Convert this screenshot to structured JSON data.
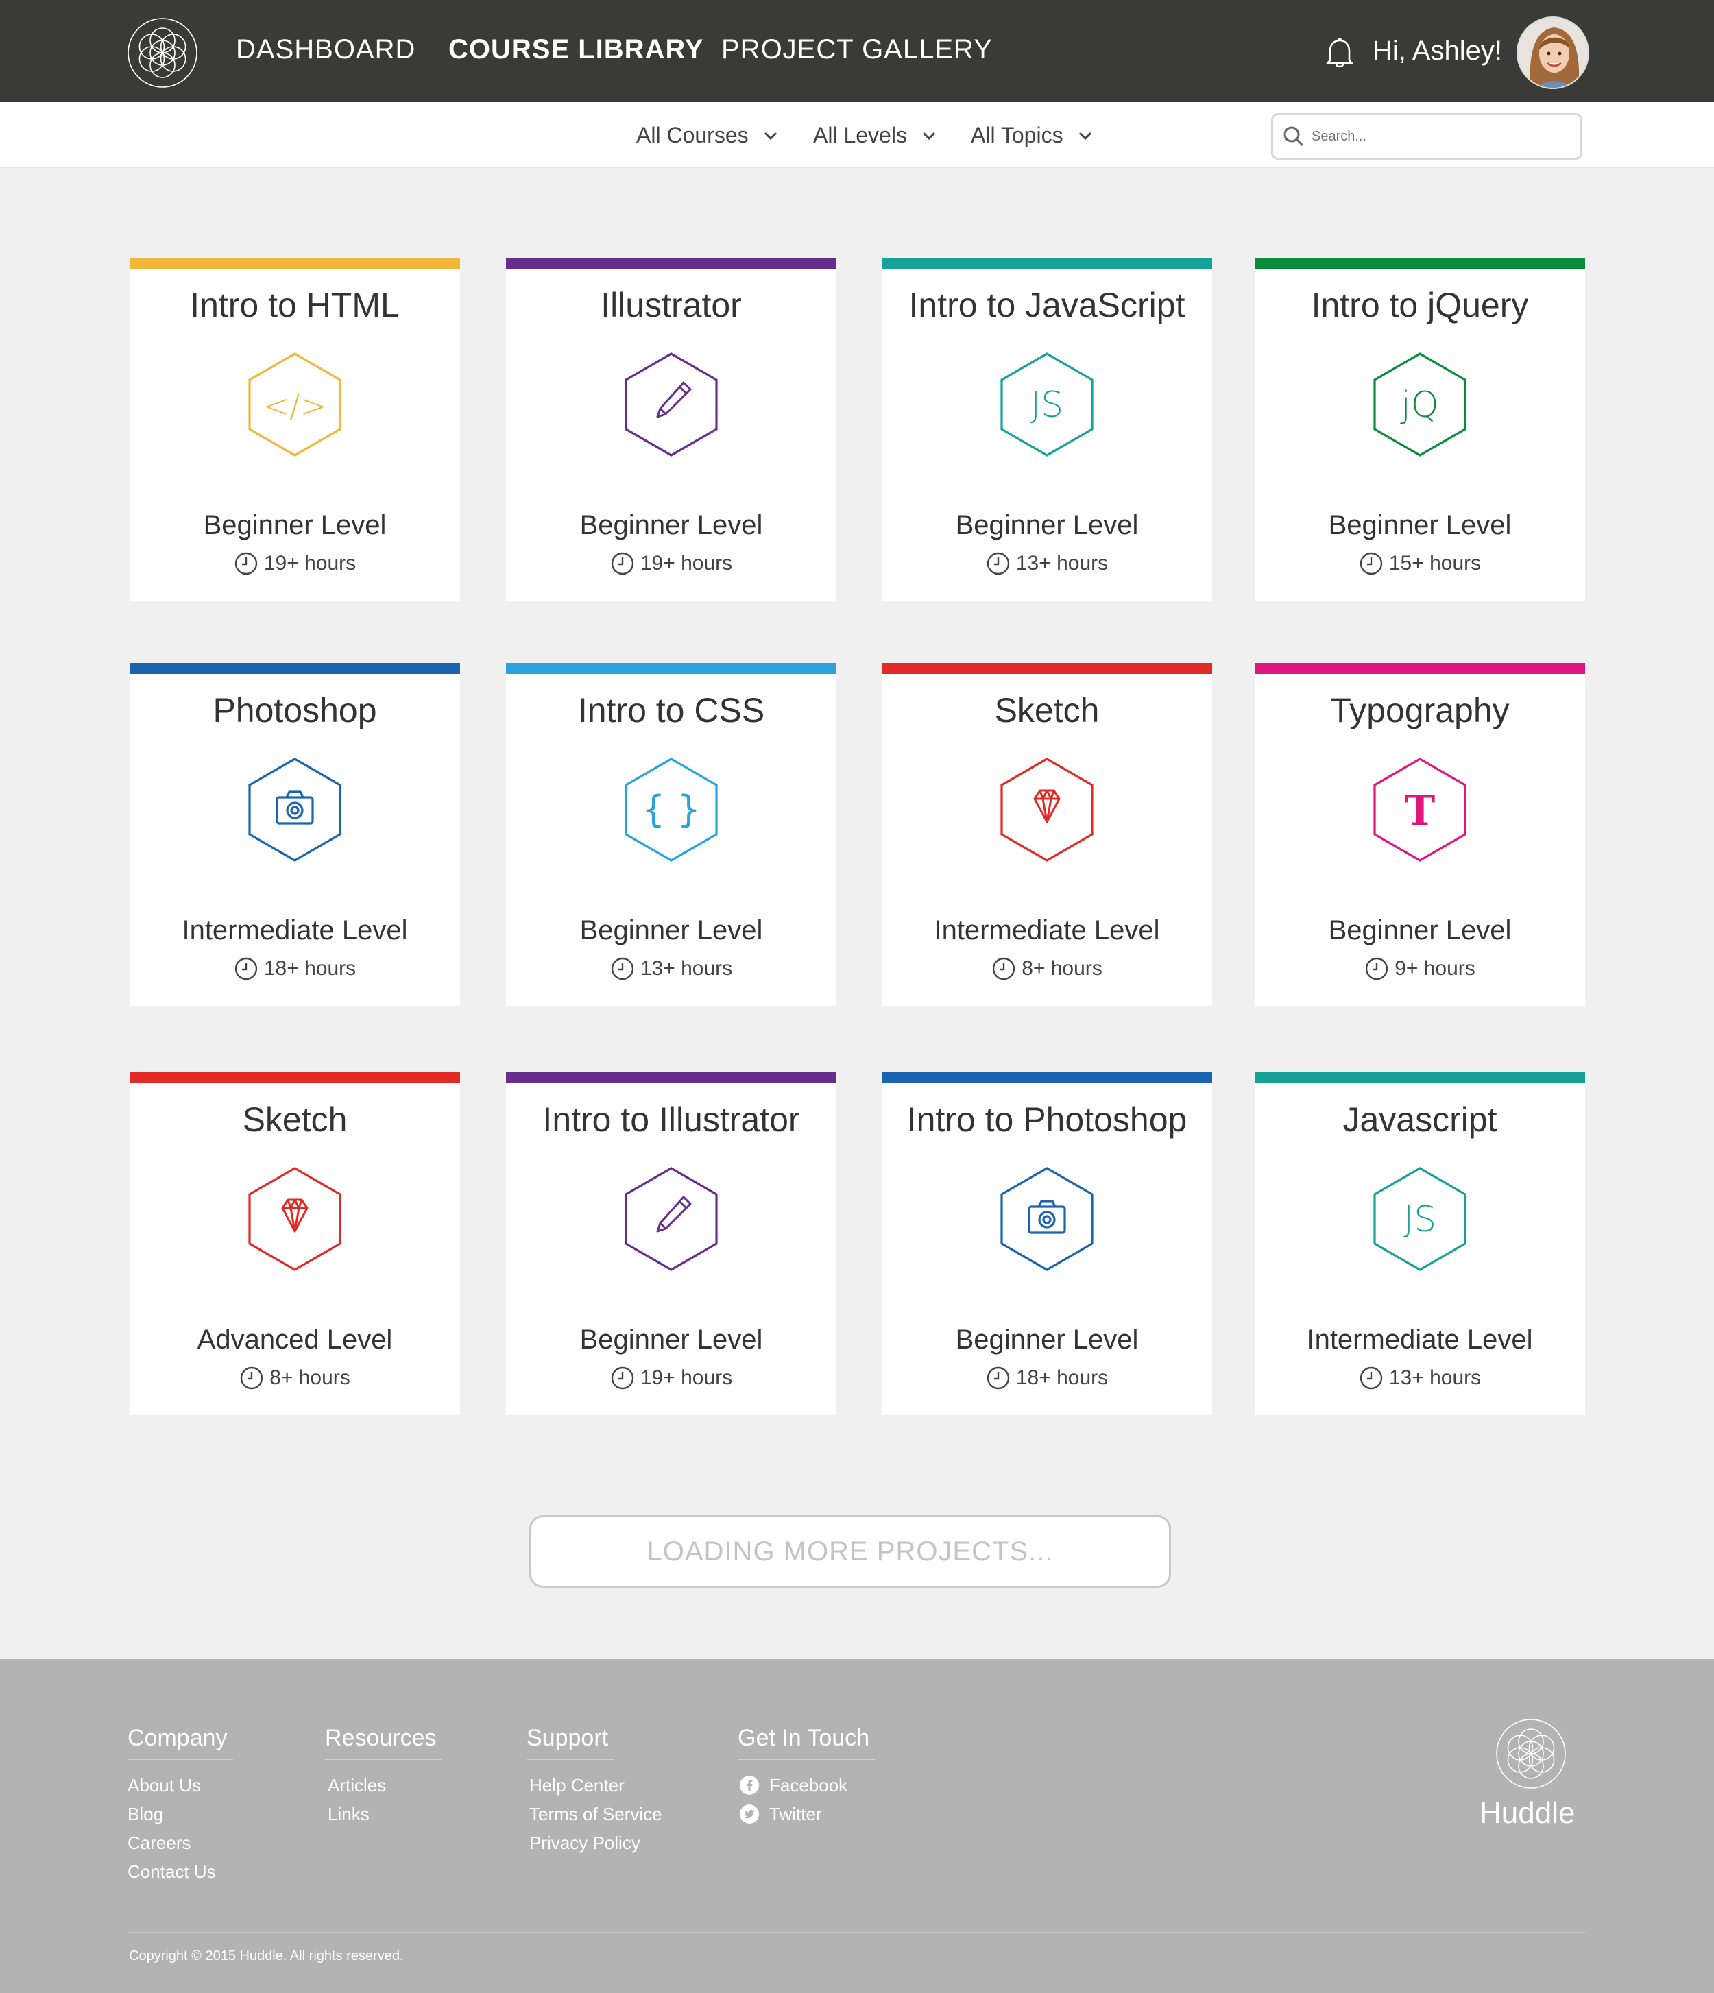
{
  "nav": {
    "links": [
      "DASHBOARD",
      "COURSE LIBRARY",
      "PROJECT GALLERY"
    ],
    "active": "COURSE LIBRARY",
    "greeting": "Hi, Ashley!"
  },
  "filters": {
    "courses": "All Courses",
    "levels": "All Levels",
    "topics": "All Topics",
    "search_placeholder": "Search..."
  },
  "courses": [
    {
      "title": "Intro to HTML",
      "icon": "code-icon",
      "color": "#f0b73b",
      "level": "Beginner Level",
      "hours": "19+ hours"
    },
    {
      "title": "Illustrator",
      "icon": "pen-icon",
      "color": "#662d8c",
      "level": "Beginner Level",
      "hours": "19+ hours"
    },
    {
      "title": "Intro to JavaScript",
      "icon": "js-icon",
      "color": "#16a199",
      "level": "Beginner Level",
      "hours": "13+ hours"
    },
    {
      "title": "Intro to jQuery",
      "icon": "jquery-icon",
      "color": "#0b8c3c",
      "level": "Beginner Level",
      "hours": "15+ hours"
    },
    {
      "title": "Photoshop",
      "icon": "camera-icon",
      "color": "#1a64b0",
      "level": "Intermediate Level",
      "hours": "18+ hours"
    },
    {
      "title": "Intro to CSS",
      "icon": "braces-icon",
      "color": "#2aa3dc",
      "level": "Beginner Level",
      "hours": "13+ hours"
    },
    {
      "title": "Sketch",
      "icon": "diamond-icon",
      "color": "#e02b27",
      "level": "Intermediate Level",
      "hours": "8+ hours"
    },
    {
      "title": "Typography",
      "icon": "typography-icon",
      "color": "#e1157e",
      "level": "Beginner Level",
      "hours": "9+ hours"
    },
    {
      "title": "Sketch",
      "icon": "diamond-icon",
      "color": "#e02b27",
      "level": "Advanced Level",
      "hours": "8+ hours"
    },
    {
      "title": "Intro to Illustrator",
      "icon": "pen-icon",
      "color": "#662d8c",
      "level": "Beginner Level",
      "hours": "19+ hours"
    },
    {
      "title": "Intro to Photoshop",
      "icon": "camera-icon",
      "color": "#1a64b0",
      "level": "Beginner Level",
      "hours": "18+ hours"
    },
    {
      "title": "Javascript",
      "icon": "js-icon",
      "color": "#16a199",
      "level": "Intermediate Level",
      "hours": "13+ hours"
    }
  ],
  "load_more": "LOADING MORE PROJECTS...",
  "footer": {
    "company": {
      "heading": "Company",
      "links": [
        "About Us",
        "Blog",
        "Careers",
        "Contact Us"
      ]
    },
    "resources": {
      "heading": "Resources",
      "links": [
        "Articles",
        "Links"
      ]
    },
    "support": {
      "heading": "Support",
      "links": [
        "Help Center",
        "Terms of Service",
        "Privacy Policy"
      ]
    },
    "contact": {
      "heading": "Get In Touch",
      "links": [
        "Facebook",
        "Twitter"
      ]
    },
    "brand": "Huddle",
    "copyright": "Copyright © 2015 Huddle. All rights reserved."
  }
}
